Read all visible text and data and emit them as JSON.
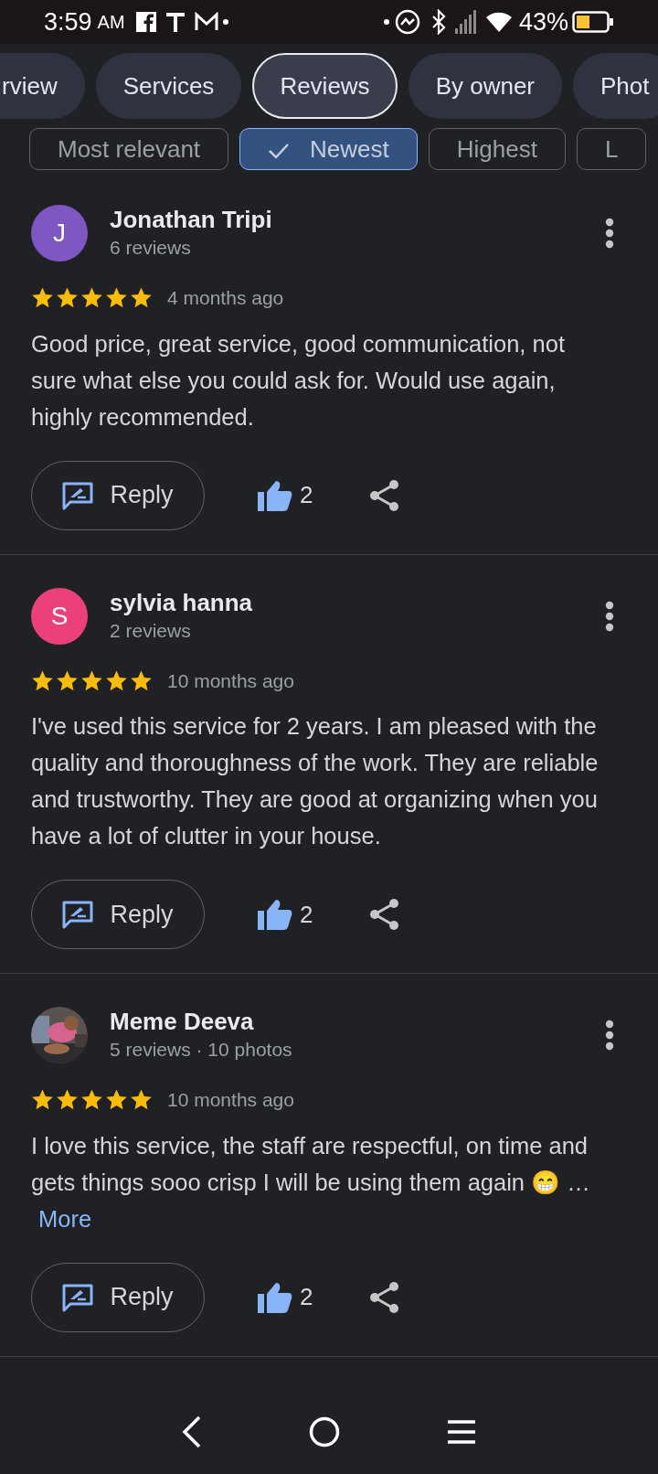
{
  "status_bar": {
    "time": "3:59",
    "meridiem": "AM",
    "battery": "43%"
  },
  "tabs": [
    {
      "label": "rview",
      "selected": false
    },
    {
      "label": "Services",
      "selected": false
    },
    {
      "label": "Reviews",
      "selected": true
    },
    {
      "label": "By owner",
      "selected": false
    },
    {
      "label": "Phot",
      "selected": false
    }
  ],
  "sort_chips": [
    {
      "label": "Most relevant",
      "selected": false
    },
    {
      "label": "Newest",
      "selected": true
    },
    {
      "label": "Highest",
      "selected": false
    },
    {
      "label": "L",
      "selected": false
    }
  ],
  "reviews": [
    {
      "avatar": {
        "kind": "letter",
        "letter": "J",
        "color": "#7e57c2"
      },
      "name": "Jonathan Tripi",
      "meta": "6 reviews",
      "stars": 5,
      "time": "4 months ago",
      "text": "Good price, great service, good communication, not sure what else you could ask for. Would use again, highly recommended.",
      "reply": "Reply",
      "likes": "2"
    },
    {
      "avatar": {
        "kind": "letter",
        "letter": "S",
        "color": "#ec407a"
      },
      "name": "sylvia hanna",
      "meta": "2 reviews",
      "stars": 5,
      "time": "10 months ago",
      "text": "I've used this service for 2 years. I am pleased with the quality and thoroughness of the work. They are reliable and trustworthy. They are good at organizing when you have a lot of clutter in your house.",
      "reply": "Reply",
      "likes": "2"
    },
    {
      "name": "Meme Deeva",
      "meta": "5 reviews · 10 photos",
      "stars": 5,
      "time": "10 months ago",
      "text": "I love this service, the staff are respectful, on time and gets things sooo crisp I will be using them again 😁 …",
      "more": "More",
      "reply": "Reply",
      "likes": "2"
    }
  ]
}
